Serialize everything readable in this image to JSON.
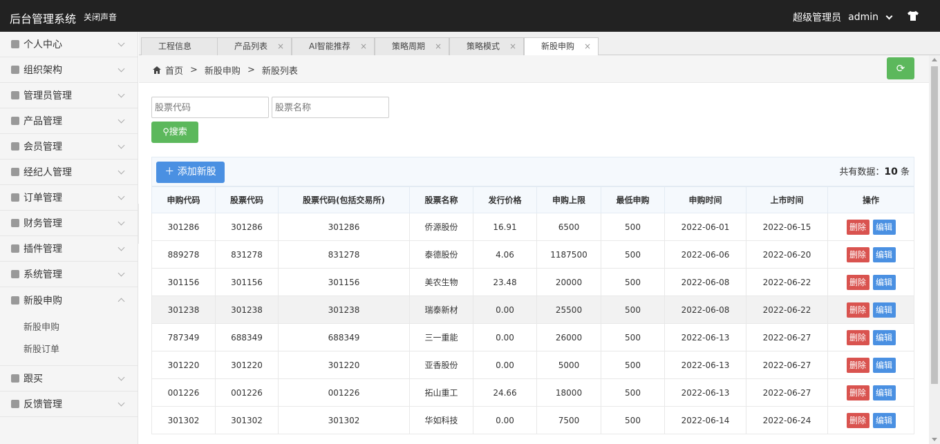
{
  "app": {
    "title": "后台管理系统",
    "mute_label": "关闭声音",
    "role": "超级管理员",
    "username": "admin"
  },
  "sidebar": {
    "items": [
      {
        "label": "个人中心"
      },
      {
        "label": "组织架构"
      },
      {
        "label": "管理员管理"
      },
      {
        "label": "产品管理"
      },
      {
        "label": "会员管理"
      },
      {
        "label": "经纪人管理"
      },
      {
        "label": "订单管理"
      },
      {
        "label": "财务管理"
      },
      {
        "label": "插件管理"
      },
      {
        "label": "系统管理"
      },
      {
        "label": "新股申购",
        "expanded": true,
        "children": [
          {
            "label": "新股申购"
          },
          {
            "label": "新股订单"
          }
        ]
      },
      {
        "label": "跟买"
      },
      {
        "label": "反馈管理"
      }
    ]
  },
  "tabs": [
    {
      "label": "工程信息"
    },
    {
      "label": "产品列表"
    },
    {
      "label": "AI智能推荐"
    },
    {
      "label": "策略周期"
    },
    {
      "label": "策略模式"
    },
    {
      "label": "新股申购",
      "active": true
    }
  ],
  "breadcrumb": {
    "home": "首页",
    "level1": "新股申购",
    "level2": "新股列表",
    "sep": ">"
  },
  "search": {
    "code_placeholder": "股票代码",
    "name_placeholder": "股票名称",
    "button": "搜索"
  },
  "toolbar": {
    "add_label": "添加新股",
    "count_prefix": "共有数据：",
    "count": "10",
    "count_suffix": "条"
  },
  "table": {
    "headers": [
      "申购代码",
      "股票代码",
      "股票代码(包括交易所)",
      "股票名称",
      "发行价格",
      "申购上限",
      "最低申购",
      "申购时间",
      "上市时间",
      "操作"
    ],
    "rows": [
      [
        "301286",
        "301286",
        "301286",
        "侨源股份",
        "16.91",
        "6500",
        "500",
        "2022-06-01",
        "2022-06-15"
      ],
      [
        "889278",
        "831278",
        "831278",
        "泰德股份",
        "4.06",
        "1187500",
        "500",
        "2022-06-06",
        "2022-06-20"
      ],
      [
        "301156",
        "301156",
        "301156",
        "美农生物",
        "23.48",
        "20000",
        "500",
        "2022-06-08",
        "2022-06-22"
      ],
      [
        "301238",
        "301238",
        "301238",
        "瑞泰新材",
        "0.00",
        "25500",
        "500",
        "2022-06-08",
        "2022-06-22"
      ],
      [
        "787349",
        "688349",
        "688349",
        "三一重能",
        "0.00",
        "26000",
        "500",
        "2022-06-13",
        "2022-06-27"
      ],
      [
        "301220",
        "301220",
        "301220",
        "亚香股份",
        "0.00",
        "5000",
        "500",
        "2022-06-13",
        "2022-06-27"
      ],
      [
        "001226",
        "001226",
        "001226",
        "拓山重工",
        "24.66",
        "18000",
        "500",
        "2022-06-13",
        "2022-06-27"
      ],
      [
        "301302",
        "301302",
        "301302",
        "华如科技",
        "0.00",
        "7500",
        "500",
        "2022-06-14",
        "2022-06-24"
      ]
    ],
    "delete_label": "删除",
    "edit_label": "编辑"
  }
}
